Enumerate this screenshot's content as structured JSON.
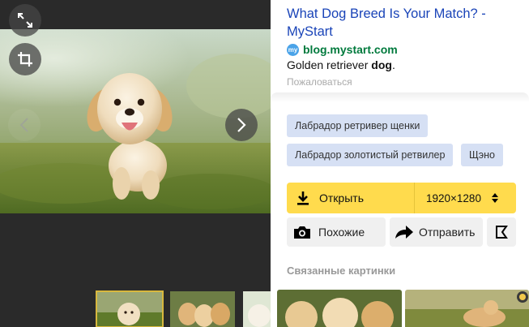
{
  "result": {
    "title": "What Dog Breed Is Your Match? - MyStart",
    "source_logo_text": "my",
    "source_domain": "blog.mystart.com",
    "snippet_prefix": "Golden retriever ",
    "snippet_bold": "dog",
    "snippet_suffix": ".",
    "complain_label": "Пожаловаться"
  },
  "tags": [
    "Лабрадор ретривер щенки",
    "Лабрадор золотистый ретвилер",
    "Щэно"
  ],
  "actions": {
    "open_label": "Открыть",
    "size_value": "1920×1280",
    "similar_label": "Похожие",
    "share_label": "Отправить"
  },
  "related": {
    "heading": "Связанные картинки"
  },
  "icons": {
    "expand": "expand-icon",
    "crop": "crop-icon",
    "prev": "chevron-left-icon",
    "next": "chevron-right-icon",
    "download": "download-icon",
    "sort": "sort-arrows-icon",
    "camera": "camera-icon",
    "share": "share-arrow-icon",
    "collection": "collection-flag-icon"
  },
  "colors": {
    "link": "#1a44b8",
    "domain": "#007a3d",
    "accent_button": "#ffdb4d",
    "chip_bg": "#d6e0f4",
    "viewer_bg": "#2a2a2a"
  }
}
